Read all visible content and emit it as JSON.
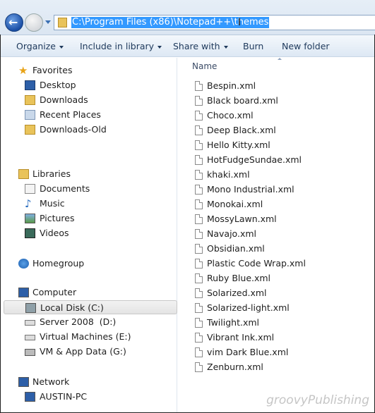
{
  "address": {
    "path": "C:\\Program Files (x86)\\Notepad++\\themes"
  },
  "toolbar": {
    "organize": "Organize",
    "include": "Include in library",
    "share": "Share with",
    "burn": "Burn",
    "new_folder": "New folder"
  },
  "nav": {
    "favorites": "Favorites",
    "fav_items": [
      "Desktop",
      "Downloads",
      "Recent Places",
      "Downloads-Old"
    ],
    "libraries": "Libraries",
    "lib_items": [
      "Documents",
      "Music",
      "Pictures",
      "Videos"
    ],
    "homegroup": "Homegroup",
    "computer": "Computer",
    "drives": [
      "Local Disk (C:)",
      "Server 2008  (D:)",
      "Virtual Machines (E:)",
      "VM & App Data (G:)"
    ],
    "network": "Network",
    "net_items": [
      "AUSTIN-PC"
    ]
  },
  "list": {
    "column": "Name",
    "files": [
      "Bespin.xml",
      "Black board.xml",
      "Choco.xml",
      "Deep Black.xml",
      "Hello Kitty.xml",
      "HotFudgeSundae.xml",
      "khaki.xml",
      "Mono Industrial.xml",
      "Monokai.xml",
      "MossyLawn.xml",
      "Navajo.xml",
      "Obsidian.xml",
      "Plastic Code Wrap.xml",
      "Ruby Blue.xml",
      "Solarized.xml",
      "Solarized-light.xml",
      "Twilight.xml",
      "Vibrant Ink.xml",
      "vim Dark Blue.xml",
      "Zenburn.xml"
    ]
  },
  "watermark": "groovyPublishing"
}
